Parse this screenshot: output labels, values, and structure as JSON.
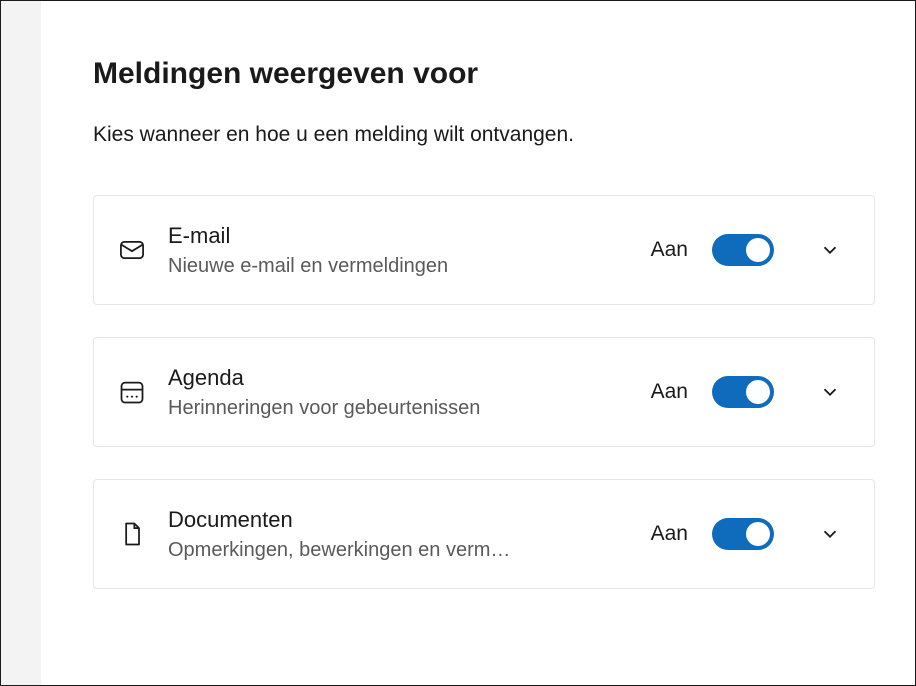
{
  "header": {
    "title": "Meldingen weergeven voor",
    "subtitle": "Kies wanneer en hoe u een melding wilt ontvangen."
  },
  "notifications": [
    {
      "icon": "mail-icon",
      "title": "E-mail",
      "description": "Nieuwe e-mail en vermeldingen",
      "status": "Aan",
      "enabled": true
    },
    {
      "icon": "calendar-icon",
      "title": "Agenda",
      "description": "Herinneringen voor gebeurtenissen",
      "status": "Aan",
      "enabled": true
    },
    {
      "icon": "document-icon",
      "title": "Documenten",
      "description": "Opmerkingen, bewerkingen en verm…",
      "status": "Aan",
      "enabled": true
    }
  ],
  "colors": {
    "accent": "#0f6cbd",
    "border": "#e5e5e5",
    "textPrimary": "#1a1a1a",
    "textSecondary": "#5a5a5a"
  }
}
